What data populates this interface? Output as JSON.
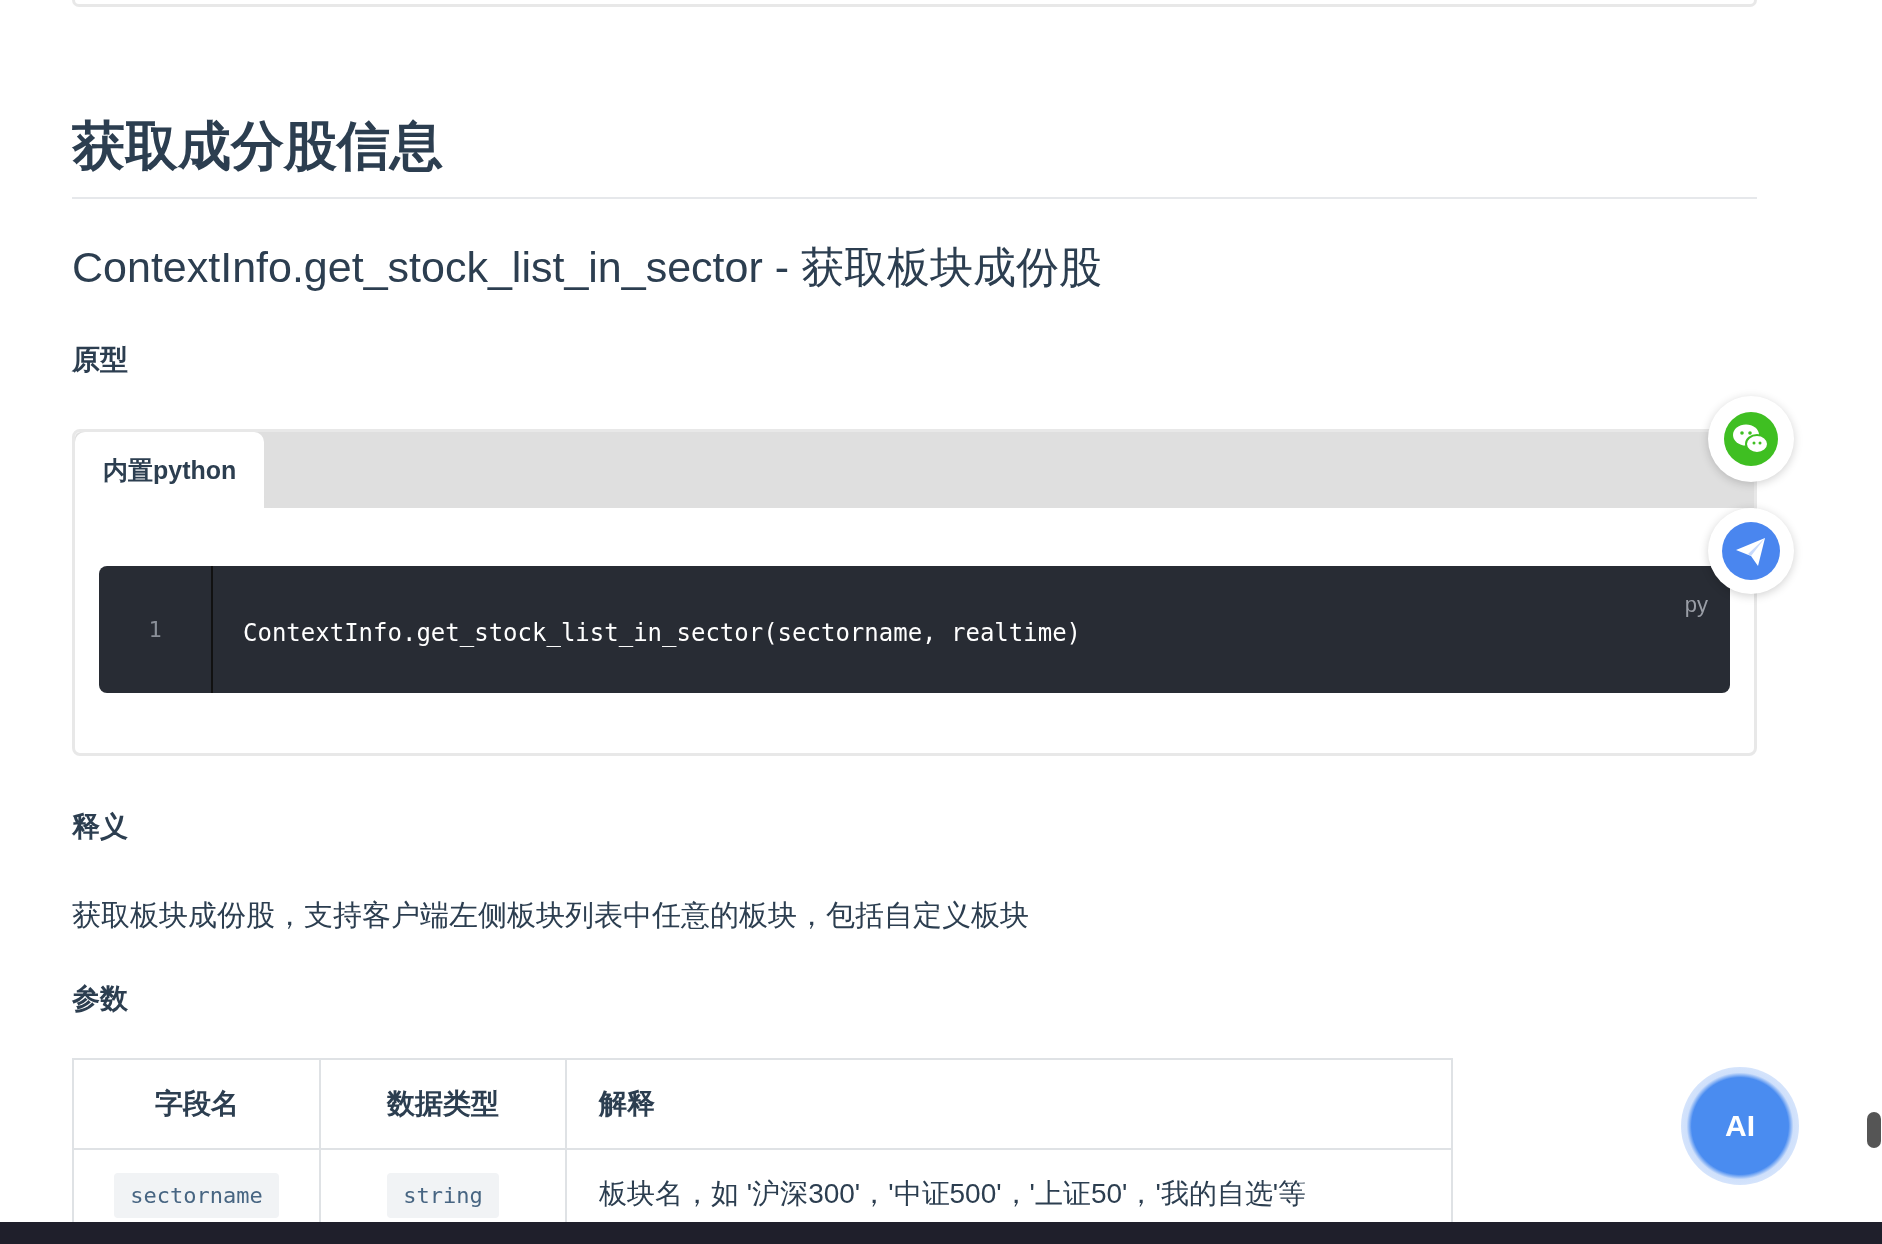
{
  "title": "获取成分股信息",
  "function_heading": "ContextInfo.get_stock_list_in_sector - 获取板块成份股",
  "prototype": {
    "heading": "原型",
    "tabs": [
      {
        "label": "内置python",
        "selected": true
      }
    ],
    "code": {
      "language": "py",
      "lines": [
        {
          "number": "1",
          "text": "ContextInfo.get_stock_list_in_sector(sectorname, realtime)"
        }
      ]
    }
  },
  "description": {
    "heading": "释义",
    "text": "获取板块成份股，支持客户端左侧板块列表中任意的板块，包括自定义板块"
  },
  "parameters": {
    "heading": "参数",
    "table": {
      "columns": [
        "字段名",
        "数据类型",
        "解释"
      ],
      "rows": [
        [
          "sectorname",
          "string",
          "板块名，如 '沪深300'，'中证500'，'上证50'，'我的自选'等"
        ]
      ]
    }
  },
  "floating_buttons": [
    {
      "kind": "wechat"
    },
    {
      "kind": "send"
    },
    {
      "kind": "ai",
      "label": "AI"
    }
  ]
}
